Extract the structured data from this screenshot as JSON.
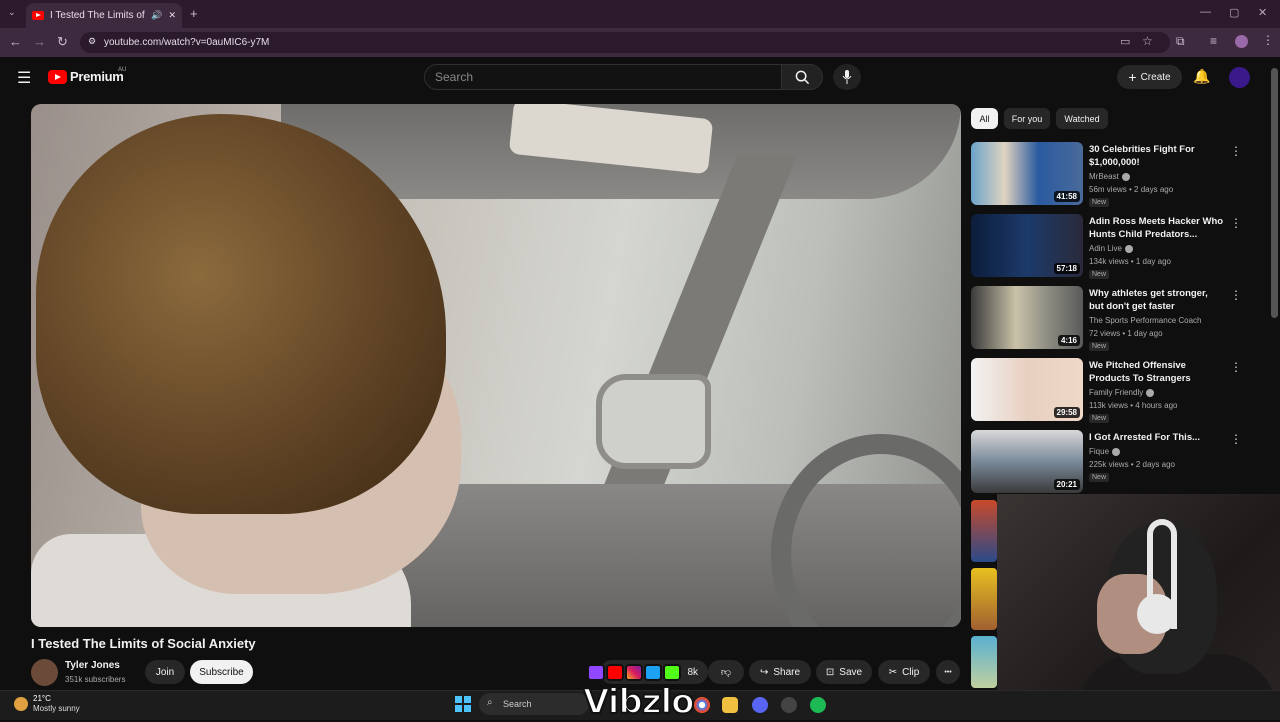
{
  "browser": {
    "tab_title": "I Tested The Limits of Social",
    "url": "youtube.com/watch?v=0auMIC6-y7M",
    "new_tab": "+",
    "minimize": "—",
    "restore": "▢",
    "close": "✕"
  },
  "header": {
    "logo_text": "Premium",
    "region": "AU",
    "search_placeholder": "Search",
    "create_label": "Create"
  },
  "video": {
    "title": "I Tested The Limits of Social Anxiety",
    "channel": "Tyler Jones",
    "subscribers": "351k subscribers",
    "join_label": "Join",
    "subscribe_label": "Subscribe",
    "like_count": "8k",
    "share_label": "Share",
    "save_label": "Save",
    "clip_label": "Clip",
    "more_label": "•••"
  },
  "chips": [
    "All",
    "For you",
    "Watched"
  ],
  "recommendations": [
    {
      "title": "30 Celebrities Fight For $1,000,000!",
      "channel": "MrBeast",
      "meta": "56m views • 2 days ago",
      "badge": "New",
      "duration": "41:58"
    },
    {
      "title": "Adin Ross Meets Hacker Who Hunts Child Predators...",
      "channel": "Adin Live",
      "meta": "134k views • 1 day ago",
      "badge": "New",
      "duration": "57:18"
    },
    {
      "title": "Why athletes get stronger, but don't get faster",
      "channel": "The Sports Performance Coach",
      "meta": "72 views • 1 day ago",
      "badge": "New",
      "duration": "4:16"
    },
    {
      "title": "We Pitched Offensive Products To Strangers",
      "channel": "Family Friendly",
      "meta": "113k views • 4 hours ago",
      "badge": "New",
      "duration": "29:58"
    },
    {
      "title": "I Got Arrested For This...",
      "channel": "Fique",
      "meta": "225k views • 2 days ago",
      "badge": "New",
      "duration": "20:21"
    }
  ],
  "overlay": {
    "brand": "Vibzlo"
  },
  "taskbar": {
    "temperature": "21°C",
    "weather": "Mostly sunny",
    "search_label": "Search"
  },
  "colors": {
    "youtube_red": "#ff0000",
    "background": "#0f0f0f",
    "chip_bg": "#272727",
    "browser_frame": "#3d2a3f"
  }
}
